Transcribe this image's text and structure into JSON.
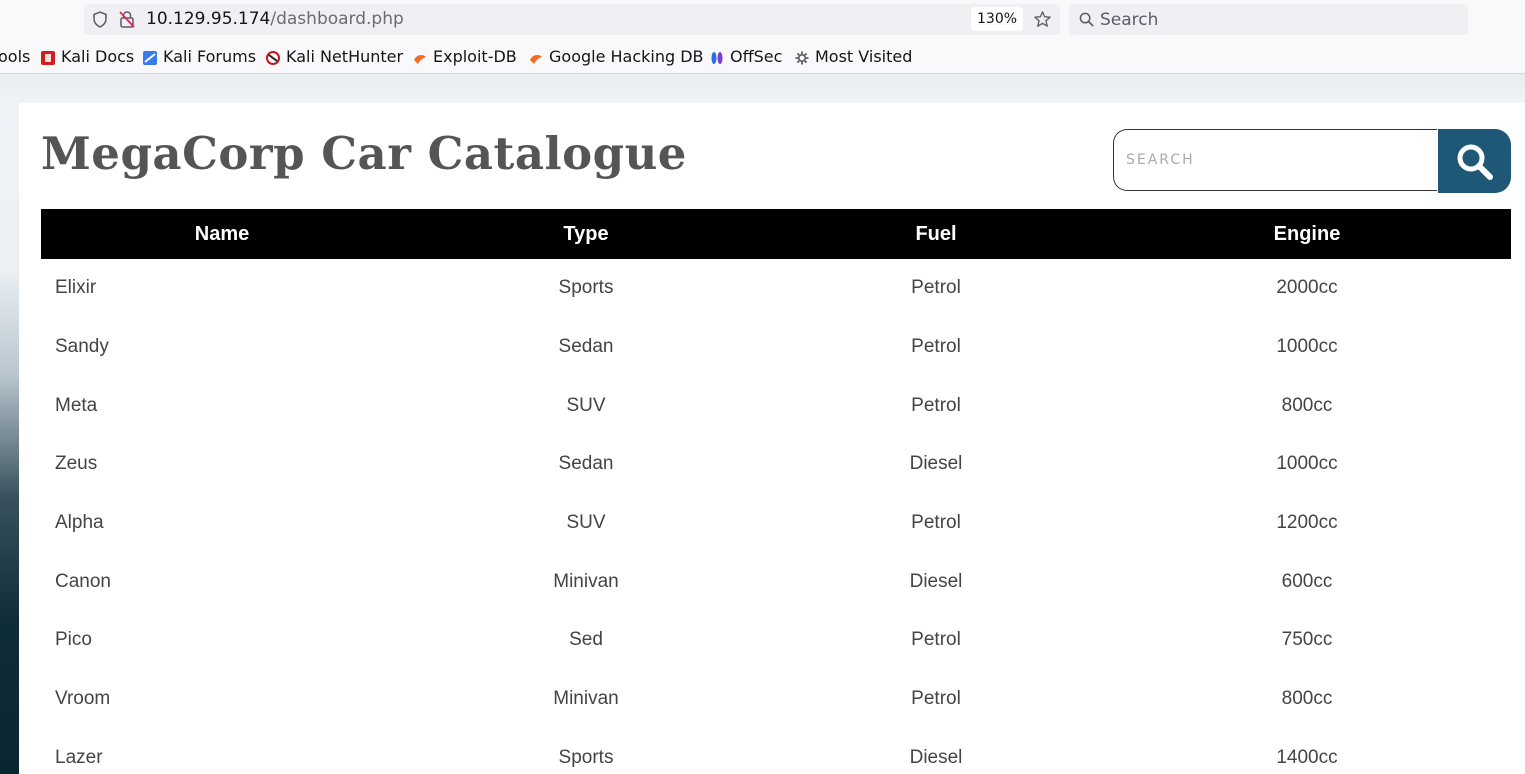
{
  "browser": {
    "url_host": "10.129.95.174",
    "url_path": "/dashboard.php",
    "zoom": "130%",
    "search_placeholder": "Search",
    "bookmarks": [
      {
        "label": "ools",
        "icon": "folder-icon"
      },
      {
        "label": "Kali Docs",
        "icon": "kali-docs-icon"
      },
      {
        "label": "Kali Forums",
        "icon": "kali-forums-icon"
      },
      {
        "label": "Kali NetHunter",
        "icon": "kali-nethunter-icon"
      },
      {
        "label": "Exploit-DB",
        "icon": "exploit-db-icon"
      },
      {
        "label": "Google Hacking DB",
        "icon": "ghdb-icon"
      },
      {
        "label": "OffSec",
        "icon": "offsec-icon"
      },
      {
        "label": "Most Visited",
        "icon": "gear-icon"
      }
    ]
  },
  "page": {
    "title": "MegaCorp Car Catalogue",
    "search_placeholder": "SEARCH",
    "accent_color": "#1f5776",
    "table": {
      "headers": [
        "Name",
        "Type",
        "Fuel",
        "Engine"
      ],
      "rows": [
        [
          "Elixir",
          "Sports",
          "Petrol",
          "2000cc"
        ],
        [
          "Sandy",
          "Sedan",
          "Petrol",
          "1000cc"
        ],
        [
          "Meta",
          "SUV",
          "Petrol",
          "800cc"
        ],
        [
          "Zeus",
          "Sedan",
          "Diesel",
          "1000cc"
        ],
        [
          "Alpha",
          "SUV",
          "Petrol",
          "1200cc"
        ],
        [
          "Canon",
          "Minivan",
          "Diesel",
          "600cc"
        ],
        [
          "Pico",
          "Sed",
          "Petrol",
          "750cc"
        ],
        [
          "Vroom",
          "Minivan",
          "Petrol",
          "800cc"
        ],
        [
          "Lazer",
          "Sports",
          "Diesel",
          "1400cc"
        ]
      ]
    }
  }
}
